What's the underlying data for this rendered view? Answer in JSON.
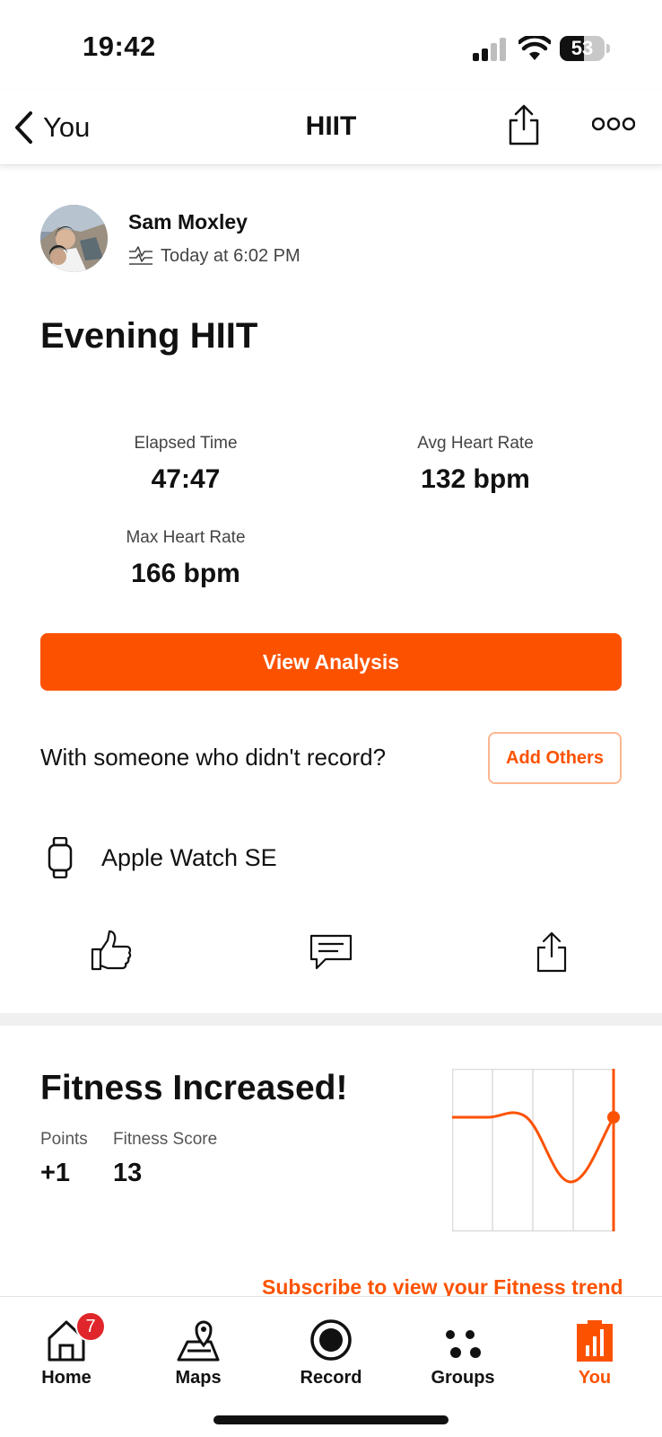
{
  "status_bar": {
    "time": "19:42",
    "battery": "53",
    "battery_level": 0.53
  },
  "nav": {
    "back_label": "You",
    "title": "HIIT"
  },
  "activity": {
    "athlete_name": "Sam Moxley",
    "timestamp": "Today at 6:02 PM",
    "title": "Evening HIIT",
    "stats": [
      {
        "label": "Elapsed Time",
        "value": "47:47"
      },
      {
        "label": "Avg Heart Rate",
        "value": "132 bpm"
      },
      {
        "label": "Max Heart Rate",
        "value": "166 bpm"
      }
    ],
    "view_analysis_label": "View Analysis",
    "with_someone_text": "With someone who didn't record?",
    "add_others_label": "Add Others",
    "device_name": "Apple Watch SE"
  },
  "fitness": {
    "title": "Fitness Increased!",
    "points_label": "Points",
    "points_value": "+1",
    "score_label": "Fitness Score",
    "score_value": "13",
    "subscribe_text": "Subscribe to view your Fitness trend"
  },
  "tabbar": {
    "items": [
      {
        "label": "Home",
        "icon": "home-icon",
        "badge": "7"
      },
      {
        "label": "Maps",
        "icon": "maps-icon"
      },
      {
        "label": "Record",
        "icon": "record-icon"
      },
      {
        "label": "Groups",
        "icon": "groups-icon"
      },
      {
        "label": "You",
        "icon": "you-icon",
        "active": true
      }
    ]
  },
  "colors": {
    "accent": "#fc5200",
    "badge": "#e0262a",
    "divider": "#f0f0f0"
  }
}
